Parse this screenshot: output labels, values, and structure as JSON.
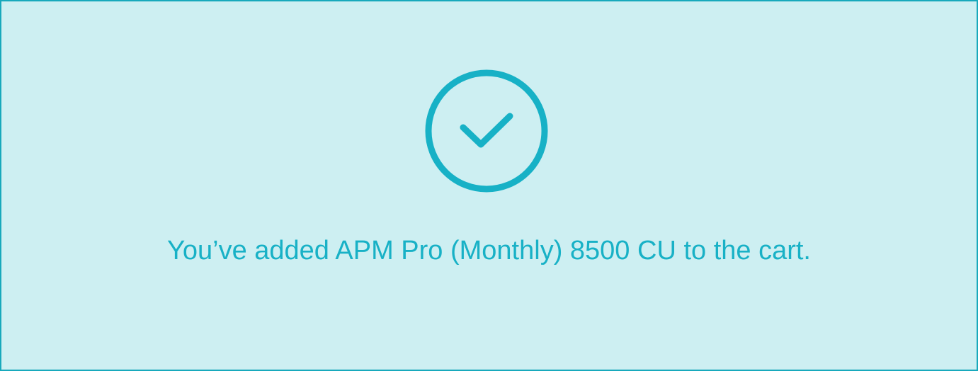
{
  "notification": {
    "icon": "check-circle-icon",
    "message": "You’ve added APM Pro (Monthly) 8500 CU to the cart."
  },
  "colors": {
    "background": "#cdeff2",
    "border": "#18a9bc",
    "accent": "#18b1c6"
  }
}
